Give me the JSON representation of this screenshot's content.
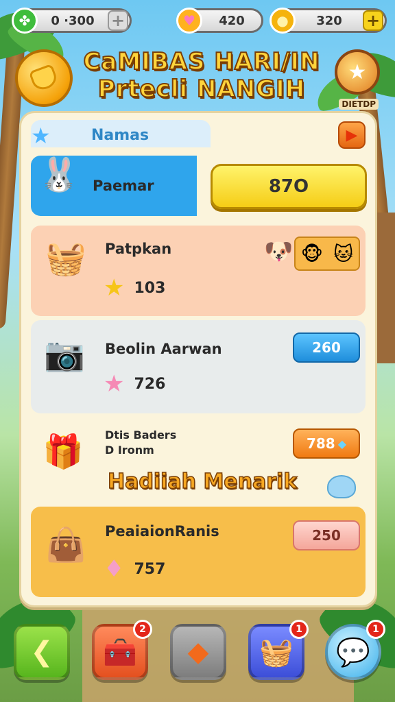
{
  "topbar": {
    "currency1": {
      "value": "0 ·300",
      "icon": "clover-icon"
    },
    "currency2": {
      "value": "420",
      "icon": "heart-coin-icon"
    },
    "currency3": {
      "value": "320",
      "icon": "gold-coin-icon"
    },
    "plus": "+"
  },
  "header": {
    "title_line1": "CaMIBAS HARI/IN",
    "title_line2": "Prtecli NANGIH",
    "badge_label": "DIETDP"
  },
  "panel": {
    "tab_label": "Namas",
    "rows": [
      {
        "label": "Paemar",
        "button": "87O",
        "icon": "rabbit-character-icon"
      },
      {
        "label": "Patpkan",
        "stat": "103",
        "stat_icon": "star-icon",
        "icon": "chest-character-icon"
      },
      {
        "label": "Beolin Aarwan",
        "stat": "726",
        "stat_icon": "pink-star-icon",
        "button": "260",
        "icon": "camera-icon"
      },
      {
        "label_line1": "Dtis Baders",
        "label_line2": "D Ironm",
        "button": "788",
        "icon": "treasure-chest-icon"
      },
      {
        "label": "PeaiaionRanis",
        "stat": "757",
        "stat_icon": "pink-gem-icon",
        "button": "250",
        "icon": "treasure-bag-icon"
      }
    ],
    "banner": "Hadiiah Menarik"
  },
  "nav": {
    "badges": [
      "2",
      "1",
      "1"
    ]
  },
  "colors": {
    "accent_yellow": "#f5cd16",
    "row_blue": "#2fa5ec",
    "row_peach": "#fcd1b4",
    "row_grey": "#e8ecec",
    "row_orange": "#f7be4a"
  }
}
